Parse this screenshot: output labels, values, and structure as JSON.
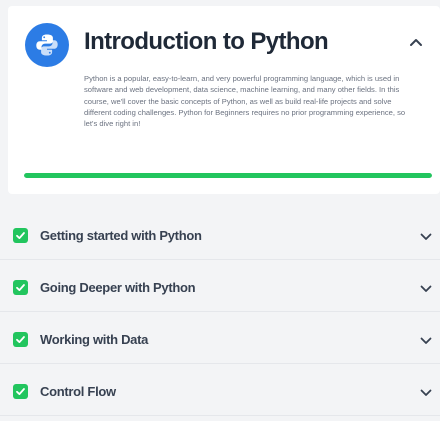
{
  "course": {
    "title": "Introduction to Python",
    "icon": "python-logo-icon",
    "description": "Python is a popular, easy-to-learn, and very powerful programming language, which is used in software and web development, data science, machine learning, and many other fields. In this course, we'll cover the basic concepts of Python, as well as build real-life projects and solve different coding challenges. Python for Beginners requires no prior programming experience, so let's dive right in!",
    "collapse_icon": "chevron-up-icon",
    "progress_percent": 100,
    "accent_color": "#2c7ce5",
    "progress_color": "#22c55e"
  },
  "modules": [
    {
      "label": "Getting started with Python",
      "completed": true
    },
    {
      "label": "Going Deeper with Python",
      "completed": true
    },
    {
      "label": "Working with Data",
      "completed": true
    },
    {
      "label": "Control Flow",
      "completed": true
    }
  ],
  "icons": {
    "check": "check-icon",
    "chevron": "chevron-down-icon"
  }
}
